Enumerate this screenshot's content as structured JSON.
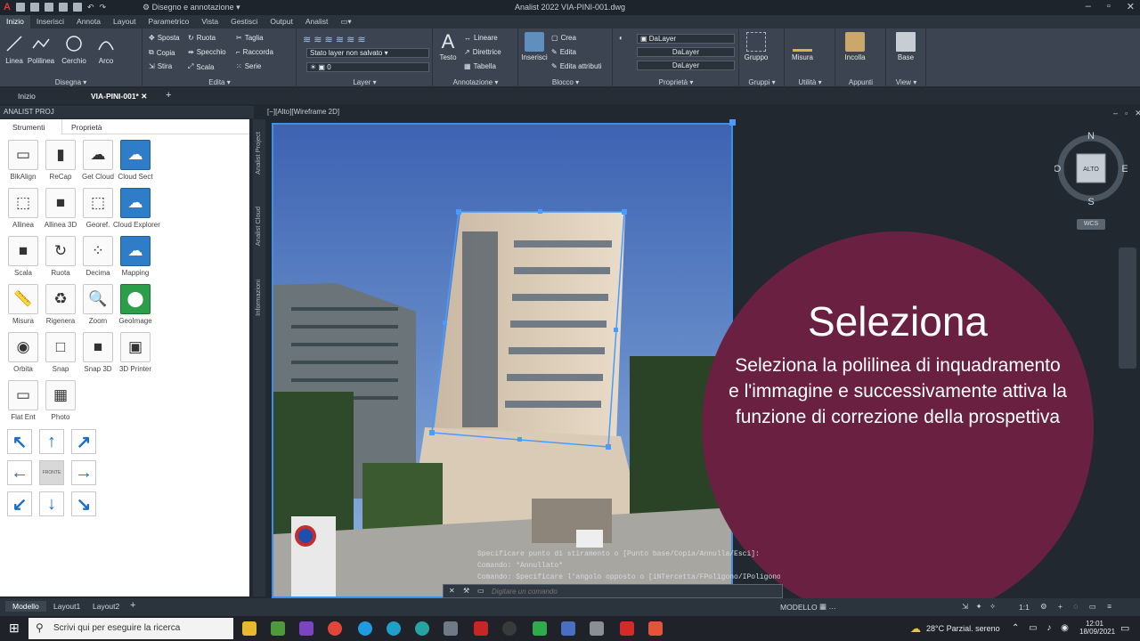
{
  "titlebar": {
    "workspace": "Disegno e annotazione",
    "title": "Analist 2022   VIA-PINI-001.dwg"
  },
  "menu": [
    "Inizio",
    "Inserisci",
    "Annota",
    "Layout",
    "Parametrico",
    "Vista",
    "Gestisci",
    "Output",
    "Analist"
  ],
  "ribbon": {
    "disegna": {
      "title": "Disegna",
      "tools": [
        "Linea",
        "Polilinea",
        "Cerchio",
        "Arco"
      ]
    },
    "edita": {
      "title": "Edita",
      "rows": [
        [
          "Sposta",
          "Ruota",
          "Taglia"
        ],
        [
          "Copia",
          "Specchio",
          "Raccorda"
        ],
        [
          "Stira",
          "Scala",
          "Serie"
        ]
      ]
    },
    "layer": {
      "title": "Layer",
      "state": "Stato layer non salvato",
      "current": "0"
    },
    "annotazione": {
      "title": "Annotazione",
      "testo": "Testo",
      "rows": [
        "Lineare",
        "Direttrice",
        "Tabella"
      ]
    },
    "blocco": {
      "title": "Blocco",
      "inserisci": "Inserisci",
      "rows": [
        "Crea",
        "Edita",
        "Edita attributi"
      ]
    },
    "proprieta": {
      "title": "Proprietà",
      "values": [
        "DaLayer",
        "DaLayer",
        "DaLayer"
      ]
    },
    "gruppi": {
      "title": "Gruppi",
      "label": "Gruppo"
    },
    "utilita": {
      "title": "Utilità",
      "label": "Misura"
    },
    "appunti": {
      "title": "Appunti",
      "label": "Incolla"
    },
    "view": {
      "title": "View",
      "label": "Base"
    }
  },
  "doctabs": {
    "home": "Inizio",
    "active": "VIA-PINI-001*"
  },
  "palette": {
    "title": "ANALIST PROJ",
    "tabs": [
      "Strumenti",
      "Proprietà"
    ],
    "tools": [
      {
        "label": "BlkAlign",
        "glyph": "▭"
      },
      {
        "label": "ReCap",
        "glyph": "▮"
      },
      {
        "label": "Get Cloud",
        "glyph": "☁"
      },
      {
        "label": "Cloud Sect",
        "glyph": "☁"
      },
      {
        "label": "Allinea",
        "glyph": "⬚"
      },
      {
        "label": "Allinea 3D",
        "glyph": "■"
      },
      {
        "label": "Georef.",
        "glyph": "⬚"
      },
      {
        "label": "Cloud Explorer",
        "glyph": "☁"
      },
      {
        "label": "Scala",
        "glyph": "■"
      },
      {
        "label": "Ruota",
        "glyph": "↻"
      },
      {
        "label": "Decima",
        "glyph": "⁘"
      },
      {
        "label": "Mapping",
        "glyph": "☁"
      },
      {
        "label": "Misura",
        "glyph": "📏"
      },
      {
        "label": "Rigenera",
        "glyph": "♻"
      },
      {
        "label": "Zoom",
        "glyph": "🔍"
      },
      {
        "label": "GeoImage",
        "glyph": "⬤"
      },
      {
        "label": "Orbita",
        "glyph": "◉"
      },
      {
        "label": "Snap",
        "glyph": "□"
      },
      {
        "label": "Snap 3D",
        "glyph": "■"
      },
      {
        "label": "3D Printer",
        "glyph": "▣"
      },
      {
        "label": "Flat Ent",
        "glyph": "▭"
      },
      {
        "label": "Photo",
        "glyph": "▦"
      }
    ],
    "center_label": "FRONTE",
    "side_tabs": [
      "Analist Project",
      "Analist Cloud",
      "Informazioni"
    ]
  },
  "viewport": {
    "label": "[−][Alto][Wireframe 2D]",
    "compass": {
      "n": "N",
      "s": "S",
      "e": "E",
      "o": "O",
      "top": "ALTO"
    },
    "wcs": "WCS"
  },
  "overlay": {
    "heading": "Seleziona",
    "body": "Seleziona la polilinea di inquadramento e l'immagine e successivamente attiva la funzione di correzione della prospettiva"
  },
  "command": {
    "history": [
      "Specificare punto di stiramento o [Punto base/Copia/Annulla/Esci]:",
      "Comando: *Annullato*",
      "Comando: Specificare l'angolo opposto o [iNTercetta/FPoligono/IPoligono]:"
    ],
    "placeholder": "Digitare un comando"
  },
  "status": {
    "tabs": [
      "Modello",
      "Layout1",
      "Layout2"
    ],
    "mode": "MODELLO",
    "scale": "1:1"
  },
  "taskbar": {
    "search": "Scrivi qui per eseguire la ricerca",
    "weather": "28°C  Parzial. sereno",
    "time": "12:01",
    "date": "18/09/2021"
  },
  "colors": {
    "accent": "#2f7dc8",
    "overlay": "#6a2141",
    "selection": "#3f8fe8"
  }
}
